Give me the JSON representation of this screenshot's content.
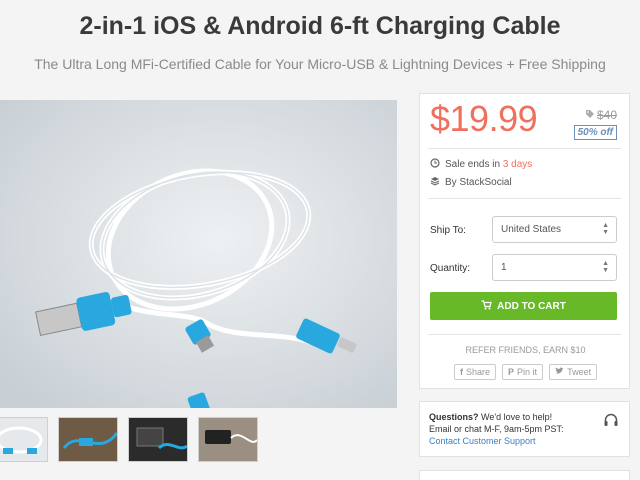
{
  "product": {
    "title": "2-in-1 iOS & Android 6-ft Charging Cable",
    "subtitle": "The Ultra Long MFi-Certified Cable for Your Micro-USB & Lightning Devices + Free Shipping"
  },
  "pricing": {
    "price": "$19.99",
    "original_price": "$40",
    "discount": "50% off",
    "price_color": "#f0705e"
  },
  "sale": {
    "prefix": "Sale ends in ",
    "remaining": "3 days",
    "seller": "By StackSocial"
  },
  "shipping": {
    "label": "Ship To:",
    "value": "United States"
  },
  "quantity": {
    "label": "Quantity:",
    "value": "1"
  },
  "cart": {
    "label": "ADD TO CART",
    "color": "#67b928"
  },
  "referral": {
    "text": "REFER FRIENDS, EARN $10",
    "share_buttons": [
      "Share",
      "Pin it",
      "Tweet"
    ]
  },
  "support": {
    "question": "Questions?",
    "intro": " We'd love to help!",
    "hours": "Email or chat M-F, 9am-5pm PST:",
    "link": "Contact Customer Support"
  },
  "icons": [
    "tag-icon",
    "clock-icon",
    "layers-icon",
    "cart-icon",
    "facebook-icon",
    "pinterest-icon",
    "twitter-icon",
    "headset-icon"
  ]
}
